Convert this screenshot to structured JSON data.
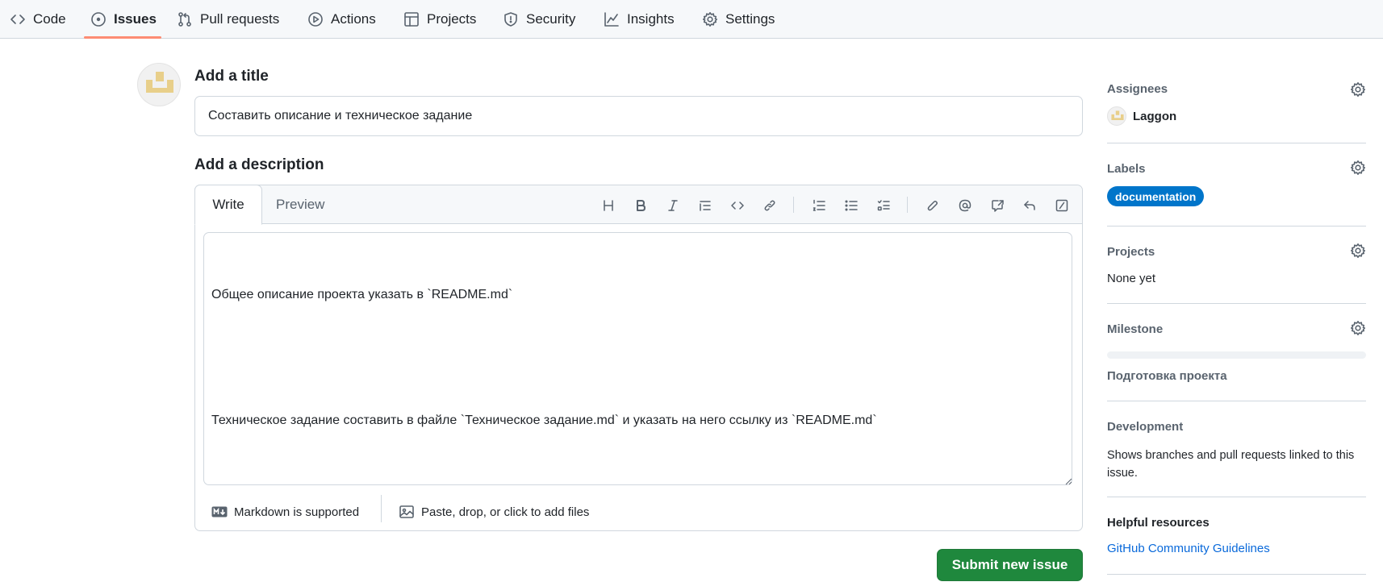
{
  "nav": {
    "tabs": [
      {
        "label": "Code",
        "icon": "code-icon"
      },
      {
        "label": "Issues",
        "icon": "issue-opened-icon",
        "active": true
      },
      {
        "label": "Pull requests",
        "icon": "git-pull-request-icon"
      },
      {
        "label": "Actions",
        "icon": "play-icon"
      },
      {
        "label": "Projects",
        "icon": "table-icon"
      },
      {
        "label": "Security",
        "icon": "shield-icon"
      },
      {
        "label": "Insights",
        "icon": "graph-icon"
      },
      {
        "label": "Settings",
        "icon": "gear-icon"
      }
    ],
    "active_underline_color": "#fd8c73"
  },
  "form": {
    "title_heading": "Add a title",
    "title_value": "Составить описание и техническое задание",
    "description_heading": "Add a description",
    "tabs": {
      "write": "Write",
      "preview": "Preview"
    },
    "toolbar": [
      "heading-icon",
      "bold-icon",
      "italic-icon",
      "quote-icon",
      "code-icon",
      "link-icon",
      "ordered-list-icon",
      "unordered-list-icon",
      "task-list-icon",
      "paperclip-icon",
      "mention-icon",
      "cross-reference-icon",
      "reply-icon",
      "slash-command-icon"
    ],
    "body_line1": "Общее описание проекта указать в `README.md`",
    "body_line2": "Техническое задание составить в файле `Техническое задание.md` и указать на него ссылку из `README.md`",
    "markdown_note": "Markdown is supported",
    "attach_note": "Paste, drop, or click to add files",
    "submit_label": "Submit new issue",
    "submit_color": "#1f883d"
  },
  "sidebar": {
    "assignees": {
      "title": "Assignees",
      "user": "Laggon"
    },
    "labels": {
      "title": "Labels",
      "label": "documentation",
      "label_color": "#0075ca"
    },
    "projects": {
      "title": "Projects",
      "value": "None yet"
    },
    "milestone": {
      "title": "Milestone",
      "value": "Подготовка проекта",
      "progress": 0
    },
    "development": {
      "title": "Development",
      "text": "Shows branches and pull requests linked to this issue."
    },
    "helpful": {
      "title": "Helpful resources",
      "link": "GitHub Community Guidelines"
    }
  }
}
